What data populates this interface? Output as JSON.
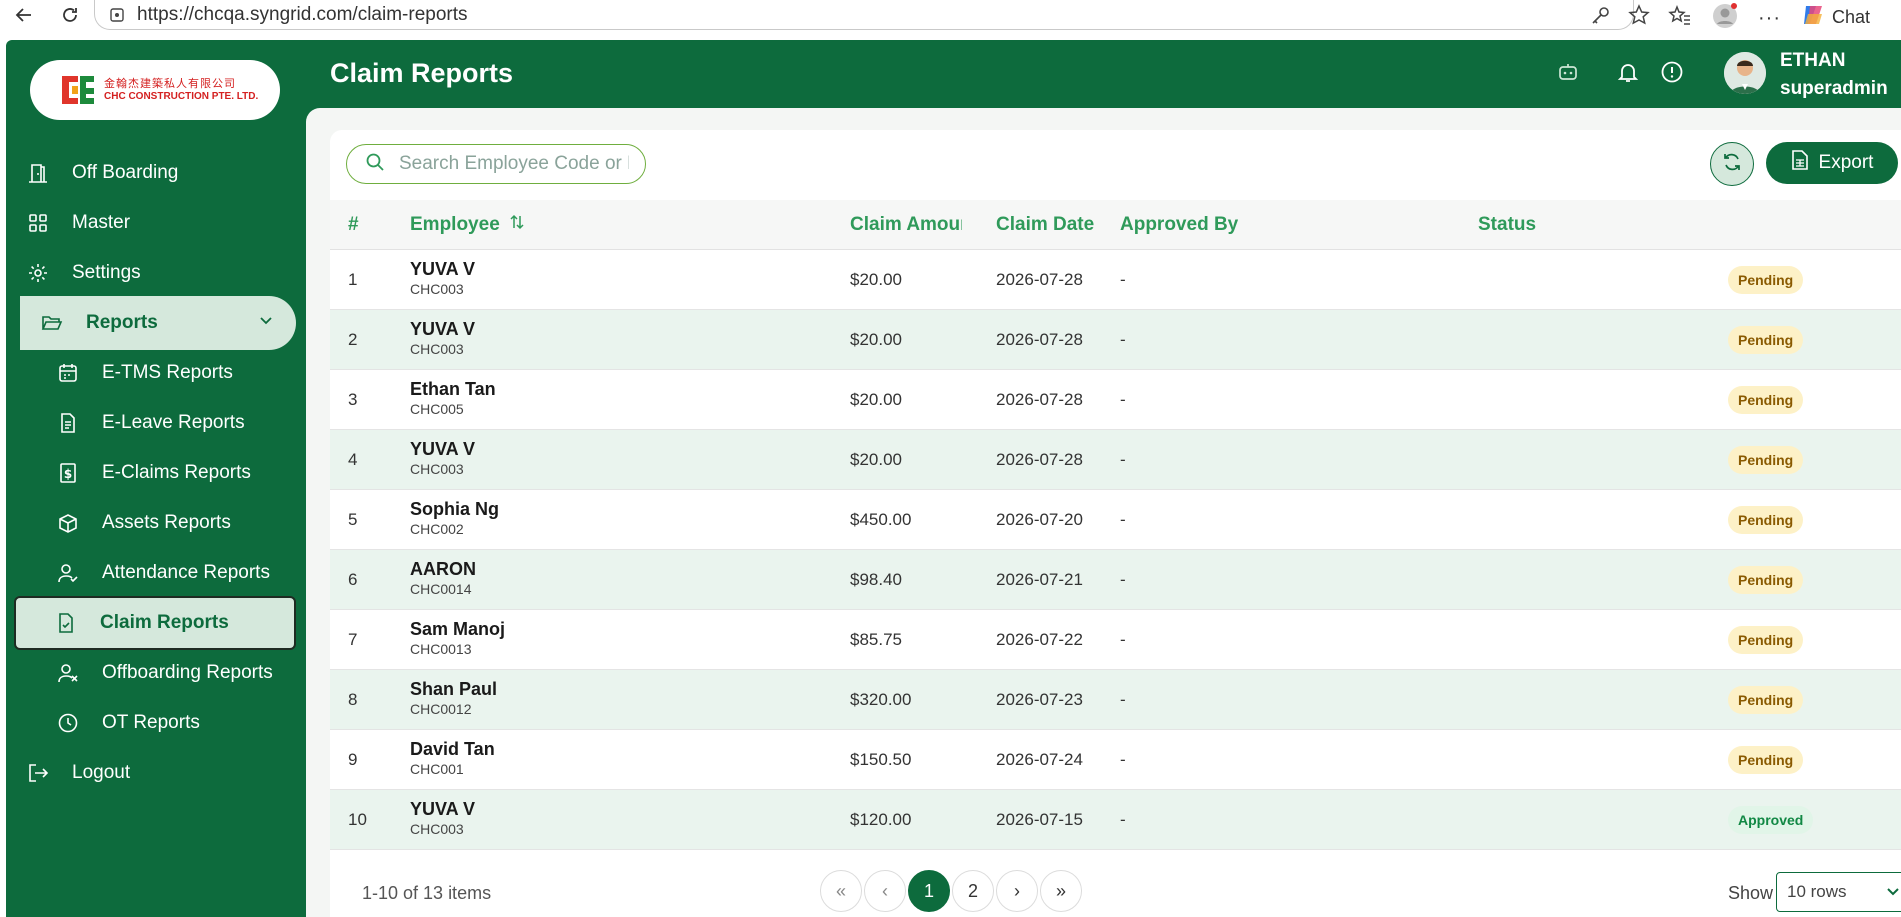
{
  "browser": {
    "url": "https://chcqa.syngrid.com/claim-reports",
    "chat_label": "Chat"
  },
  "logo": {
    "cn": "金翰杰建築私人有限公司",
    "en": "CHC CONSTRUCTION PTE. LTD."
  },
  "sidebar": {
    "items": [
      {
        "label": "Off Boarding",
        "icon": "door-icon"
      },
      {
        "label": "Master",
        "icon": "grid-icon"
      },
      {
        "label": "Settings",
        "icon": "gear-icon"
      },
      {
        "label": "Reports",
        "icon": "folder-open-icon"
      }
    ],
    "sub_items": [
      {
        "label": "E-TMS Reports",
        "icon": "calendar-icon"
      },
      {
        "label": "E-Leave Reports",
        "icon": "document-icon"
      },
      {
        "label": "E-Claims Reports",
        "icon": "dollar-icon"
      },
      {
        "label": "Assets Reports",
        "icon": "box-icon"
      },
      {
        "label": "Attendance Reports",
        "icon": "user-check-icon"
      },
      {
        "label": "Claim Reports",
        "icon": "file-check-icon"
      },
      {
        "label": "Offboarding Reports",
        "icon": "user-x-icon"
      },
      {
        "label": "OT Reports",
        "icon": "clock-icon"
      }
    ],
    "logout_label": "Logout"
  },
  "header": {
    "title": "Claim Reports",
    "user_name": "ETHAN",
    "user_role": "superadmin"
  },
  "toolbar": {
    "search_placeholder": "Search Employee Code or Name",
    "export_label": "Export"
  },
  "table": {
    "headers": {
      "index": "#",
      "employee": "Employee",
      "claim_amount": "Claim Amount",
      "claim_date": "Claim Date",
      "approved_by": "Approved By",
      "status": "Status"
    },
    "rows": [
      {
        "n": "1",
        "name": "YUVA V",
        "code": "CHC003",
        "amount": "$20.00",
        "date": "2026-07-28",
        "approver": "-",
        "status": "Pending"
      },
      {
        "n": "2",
        "name": "YUVA V",
        "code": "CHC003",
        "amount": "$20.00",
        "date": "2026-07-28",
        "approver": "-",
        "status": "Pending"
      },
      {
        "n": "3",
        "name": "Ethan Tan",
        "code": "CHC005",
        "amount": "$20.00",
        "date": "2026-07-28",
        "approver": "-",
        "status": "Pending"
      },
      {
        "n": "4",
        "name": "YUVA V",
        "code": "CHC003",
        "amount": "$20.00",
        "date": "2026-07-28",
        "approver": "-",
        "status": "Pending"
      },
      {
        "n": "5",
        "name": "Sophia Ng",
        "code": "CHC002",
        "amount": "$450.00",
        "date": "2026-07-20",
        "approver": "-",
        "status": "Pending"
      },
      {
        "n": "6",
        "name": "AARON",
        "code": "CHC0014",
        "amount": "$98.40",
        "date": "2026-07-21",
        "approver": "-",
        "status": "Pending"
      },
      {
        "n": "7",
        "name": "Sam Manoj",
        "code": "CHC0013",
        "amount": "$85.75",
        "date": "2026-07-22",
        "approver": "-",
        "status": "Pending"
      },
      {
        "n": "8",
        "name": "Shan Paul",
        "code": "CHC0012",
        "amount": "$320.00",
        "date": "2026-07-23",
        "approver": "-",
        "status": "Pending"
      },
      {
        "n": "9",
        "name": "David Tan",
        "code": "CHC001",
        "amount": "$150.50",
        "date": "2026-07-24",
        "approver": "-",
        "status": "Pending"
      },
      {
        "n": "10",
        "name": "YUVA V",
        "code": "CHC003",
        "amount": "$120.00",
        "date": "2026-07-15",
        "approver": "-",
        "status": "Approved"
      }
    ]
  },
  "pagination": {
    "info": "1-10 of 13 items",
    "pages": [
      "1",
      "2"
    ],
    "current": "1",
    "show_label": "Show",
    "rows_value": "10 rows"
  },
  "colors": {
    "brand_green": "#0d6b3d",
    "accent_green": "#2f9a5a",
    "pending_bg": "#fdf1c7",
    "approved_bg": "#e1f5e8"
  }
}
